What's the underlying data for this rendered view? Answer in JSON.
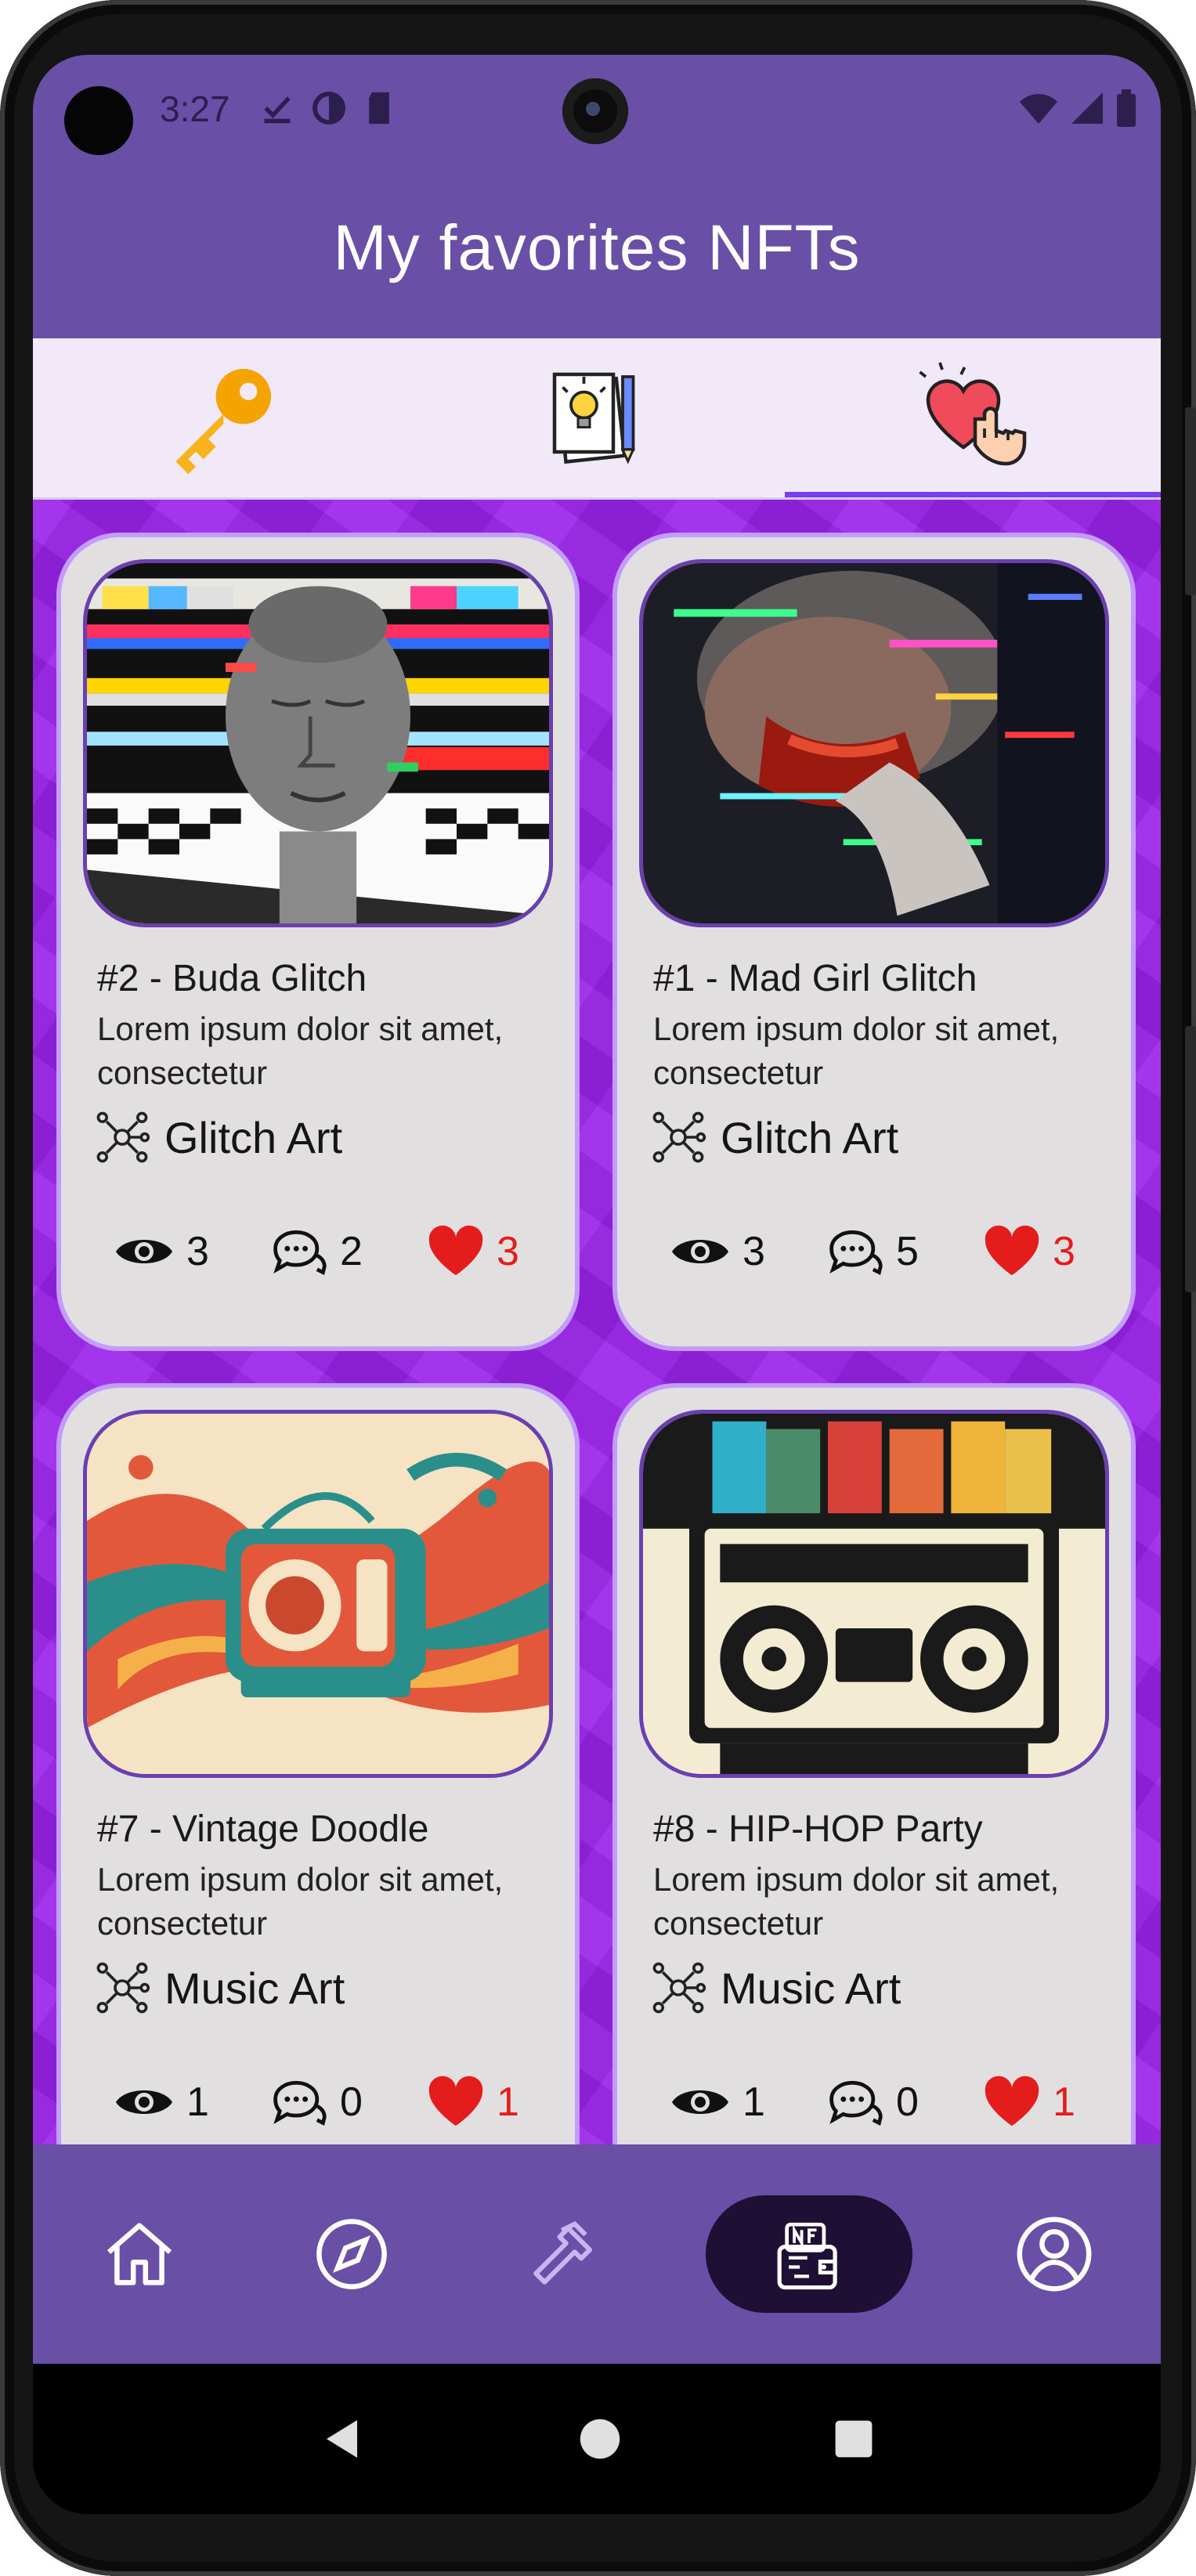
{
  "status_bar": {
    "time": "3:27"
  },
  "header": {
    "title": "My favorites NFTs"
  },
  "tabs": [
    {
      "icon": "key-icon",
      "active": false
    },
    {
      "icon": "ideas-notebook-icon",
      "active": false
    },
    {
      "icon": "heart-hand-icon",
      "active": true
    }
  ],
  "cards": [
    {
      "title": "#2 - Buda Glitch",
      "description": "Lorem ipsum dolor sit amet, consectetur",
      "category": "Glitch Art",
      "views": "3",
      "comments": "2",
      "likes": "3"
    },
    {
      "title": "#1 - Mad Girl Glitch",
      "description": "Lorem ipsum dolor sit amet, consectetur",
      "category": "Glitch Art",
      "views": "3",
      "comments": "5",
      "likes": "3"
    },
    {
      "title": "#7 - Vintage Doodle",
      "description": "Lorem ipsum dolor sit amet, consectetur",
      "category": "Music Art",
      "views": "1",
      "comments": "0",
      "likes": "1"
    },
    {
      "title": "#8 - HIP-HOP Party",
      "description": "Lorem ipsum dolor sit amet, consectetur",
      "category": "Music Art",
      "views": "1",
      "comments": "0",
      "likes": "1"
    }
  ],
  "bottom_nav": [
    {
      "icon": "home-icon",
      "active": false
    },
    {
      "icon": "compass-icon",
      "active": false
    },
    {
      "icon": "hammer-icon",
      "active": false
    },
    {
      "icon": "nft-wallet-icon",
      "active": true
    },
    {
      "icon": "profile-icon",
      "active": false
    }
  ],
  "colors": {
    "header": "#6a4fa7",
    "grid_background": "#9a22ea",
    "card": "#e1dfe0",
    "like": "#e41c1c",
    "active_tab": "#7a3df0"
  }
}
